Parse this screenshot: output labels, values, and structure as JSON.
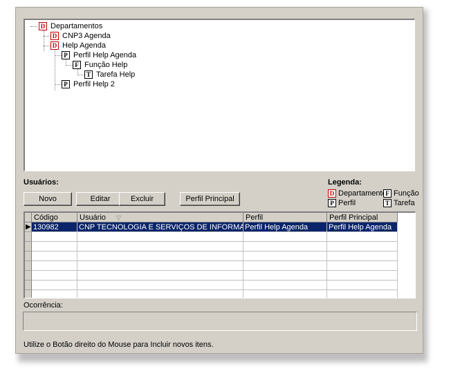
{
  "tree": {
    "nodes": [
      {
        "icon": "D",
        "label": "Departamentos"
      },
      {
        "icon": "D",
        "label": "CNP3 Agenda"
      },
      {
        "icon": "D",
        "label": "Help Agenda"
      },
      {
        "icon": "P",
        "label": "Perfil Help Agenda"
      },
      {
        "icon": "F",
        "label": "Função Help"
      },
      {
        "icon": "T",
        "label": "Tarefa Help"
      },
      {
        "icon": "P",
        "label": "Perfil Help 2"
      }
    ]
  },
  "usuarios_label": "Usuários:",
  "buttons": {
    "novo": "Novo",
    "editar": "Editar",
    "excluir": "Excluir",
    "perfil_principal": "Perfil Principal"
  },
  "legend": {
    "title": "Legenda:",
    "items": [
      {
        "icon": "D",
        "label": "Departamento"
      },
      {
        "icon": "F",
        "label": "Função"
      },
      {
        "icon": "P",
        "label": "Perfil"
      },
      {
        "icon": "T",
        "label": "Tarefa"
      }
    ]
  },
  "grid": {
    "columns": [
      "Código",
      "Usuário",
      "Perfil",
      "Perfil Principal"
    ],
    "rows": [
      [
        "130982",
        "CNP TECNOLOGIA E SERVIÇOS DE INFORMATICA",
        "Perfil Help Agenda",
        "Perfil Help Agenda"
      ]
    ]
  },
  "ocorrencia_label": "Ocorrência:",
  "ocorrencia_value": "",
  "status_text": "Utilize o Botão direito do Mouse para Incluir novos itens.",
  "colors": {
    "department_icon": "#c00000",
    "selection": "#0a246a"
  }
}
